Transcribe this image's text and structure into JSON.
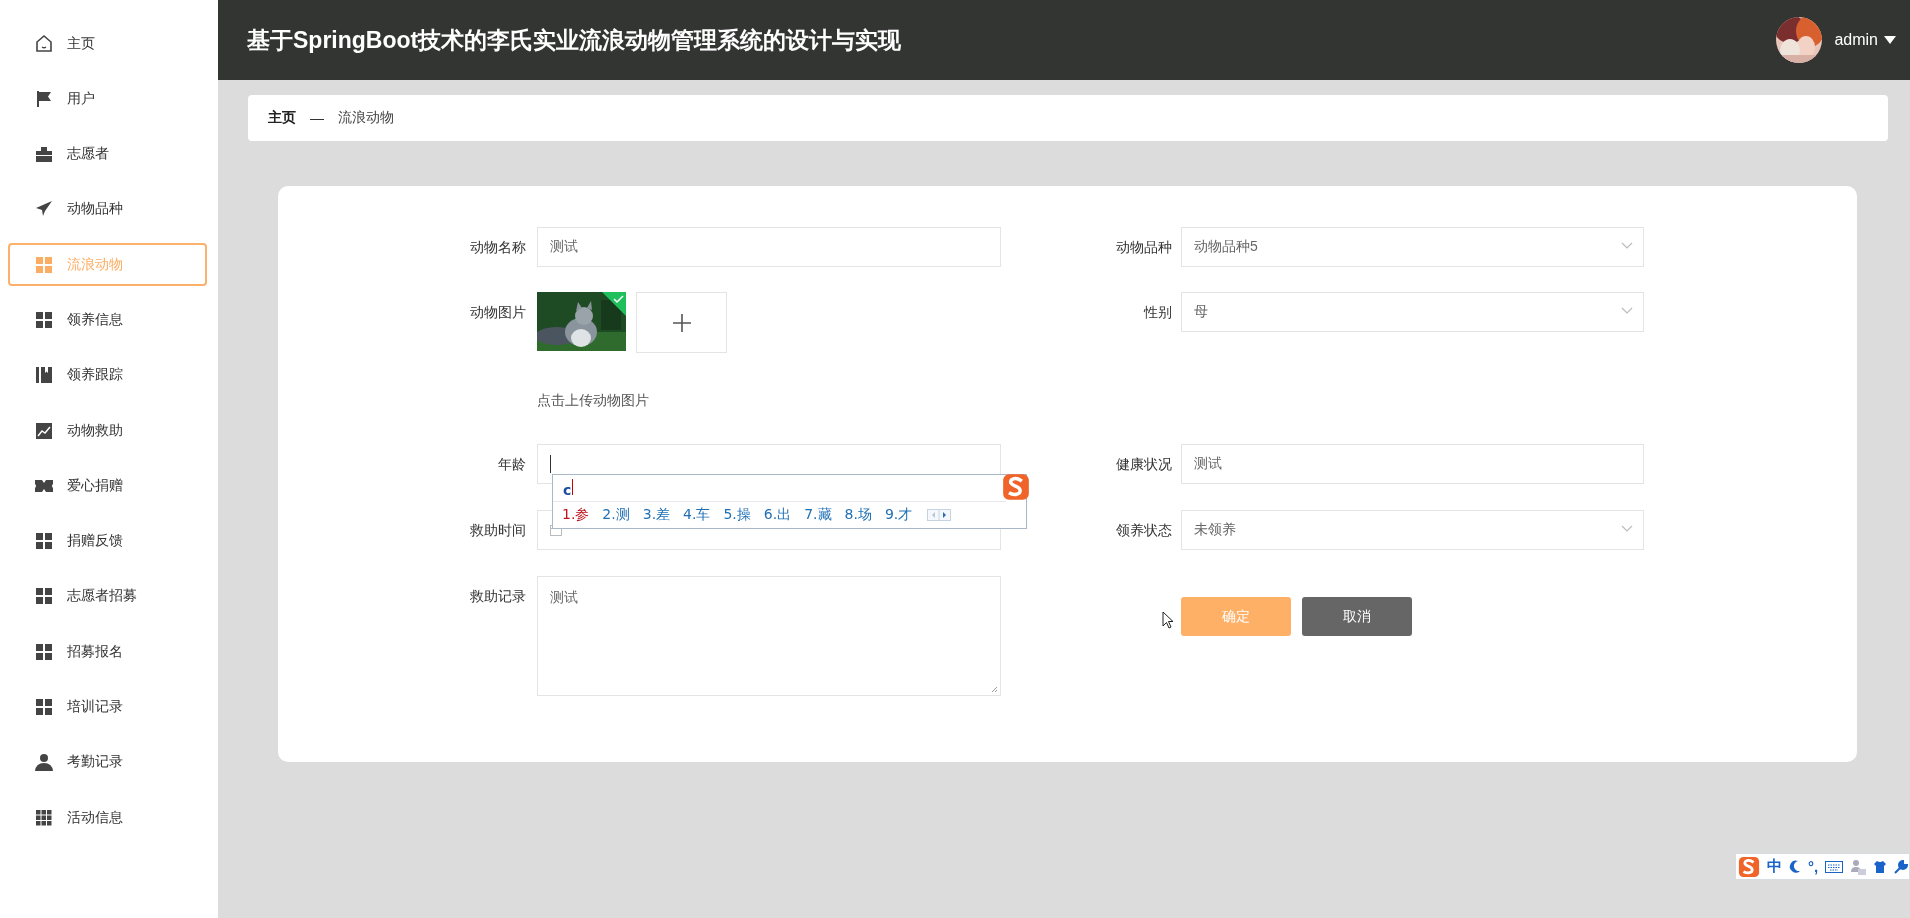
{
  "sidebar": {
    "items": [
      {
        "label": "主页",
        "selected": false
      },
      {
        "label": "用户",
        "selected": false
      },
      {
        "label": "志愿者",
        "selected": false
      },
      {
        "label": "动物品种",
        "selected": false
      },
      {
        "label": "流浪动物",
        "selected": true
      },
      {
        "label": "领养信息",
        "selected": false
      },
      {
        "label": "领养跟踪",
        "selected": false
      },
      {
        "label": "动物救助",
        "selected": false
      },
      {
        "label": "爱心捐赠",
        "selected": false
      },
      {
        "label": "捐赠反馈",
        "selected": false
      },
      {
        "label": "志愿者招募",
        "selected": false
      },
      {
        "label": "招募报名",
        "selected": false
      },
      {
        "label": "培训记录",
        "selected": false
      },
      {
        "label": "考勤记录",
        "selected": false
      },
      {
        "label": "活动信息",
        "selected": false
      }
    ]
  },
  "header": {
    "title": "基于SpringBoot技术的李氏实业流浪动物管理系统的设计与实现",
    "user": {
      "name": "admin"
    }
  },
  "breadcrumb": {
    "items": [
      {
        "label": "主页",
        "current": false
      },
      {
        "label": "流浪动物",
        "current": true
      }
    ],
    "separator": "—"
  },
  "form": {
    "rows": [
      {
        "fields": [
          {
            "label": "动物名称",
            "kind": "text",
            "value": "测试"
          },
          {
            "label": "动物品种",
            "kind": "select",
            "value": "动物品种5"
          }
        ]
      },
      {
        "fields": [
          {
            "label": "动物图片",
            "kind": "upload",
            "uploaded": true,
            "hint": "点击上传动物图片"
          },
          {
            "label": "性别",
            "kind": "select",
            "value": "母"
          }
        ]
      },
      {
        "fields": [
          {
            "label": "年龄",
            "kind": "text",
            "focused": true
          },
          {
            "label": "健康状况",
            "kind": "text",
            "value": "测试"
          }
        ]
      },
      {
        "fields": [
          {
            "label": "救助时间",
            "kind": "date"
          },
          {
            "label": "领养状态",
            "kind": "select",
            "value": "未领养"
          }
        ]
      },
      {
        "fields": [
          {
            "label": "救助记录",
            "kind": "textarea",
            "value": "测试"
          }
        ]
      }
    ],
    "buttons": [
      {
        "label": "确定",
        "kind": "primary"
      },
      {
        "label": "取消",
        "kind": "secondary"
      }
    ]
  },
  "ime": {
    "composition": "c",
    "candidates": [
      {
        "label": "1.参",
        "selected": true
      },
      {
        "label": "2.测",
        "selected": false
      },
      {
        "label": "3.差",
        "selected": false
      },
      {
        "label": "4.车",
        "selected": false
      },
      {
        "label": "5.操",
        "selected": false
      },
      {
        "label": "6.出",
        "selected": false
      },
      {
        "label": "7.藏",
        "selected": false
      },
      {
        "label": "8.场",
        "selected": false
      },
      {
        "label": "9.才",
        "selected": false
      }
    ]
  },
  "ime_toolbar": {
    "mode": "中",
    "punctuation": "°,"
  }
}
